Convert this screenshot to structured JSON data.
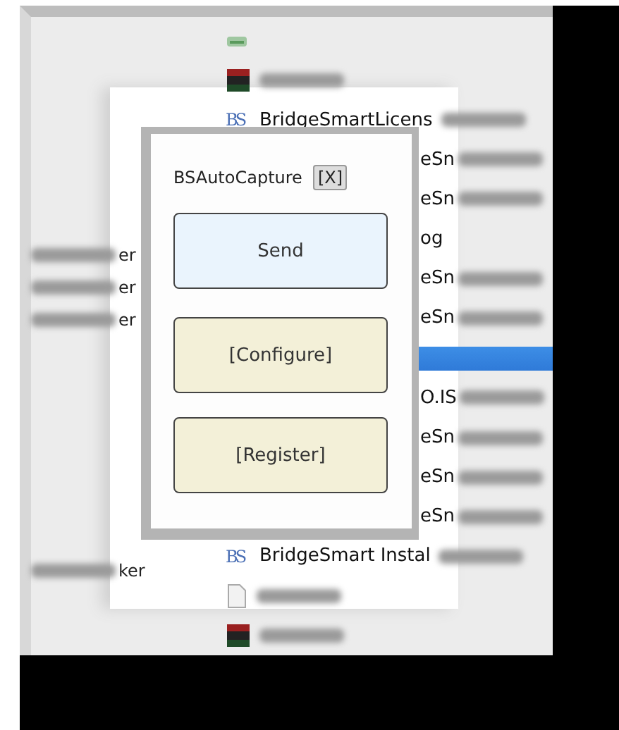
{
  "left_pane": {
    "items": [
      {
        "text": "er",
        "blurred": true
      },
      {
        "text": "er",
        "blurred": true
      },
      {
        "text": "er",
        "blurred": true
      },
      {
        "text": "ker",
        "blurred": true
      }
    ]
  },
  "file_list": {
    "items": [
      {
        "kind": "drive",
        "blurred": false,
        "selected": false
      },
      {
        "kind": "archive",
        "blurred": true,
        "selected": false
      },
      {
        "kind": "logo",
        "logo": "BS",
        "text": "BridgeSmartLicens",
        "blurred": true,
        "selected": false
      },
      {
        "kind": "covered",
        "text": "eSn",
        "blurred": true,
        "selected": false
      },
      {
        "kind": "covered",
        "text": "eSn",
        "blurred": true,
        "selected": false
      },
      {
        "kind": "covered",
        "text": "og",
        "blurred": false,
        "selected": false
      },
      {
        "kind": "covered",
        "text": "eSn",
        "blurred": true,
        "selected": false
      },
      {
        "kind": "covered",
        "text": "eSn",
        "blurred": true,
        "selected": false
      },
      {
        "kind": "covered",
        "blurred": false,
        "selected": true
      },
      {
        "kind": "covered",
        "text": "O.IS",
        "blurred": true,
        "selected": false
      },
      {
        "kind": "covered",
        "text": "eSn",
        "blurred": true,
        "selected": false
      },
      {
        "kind": "covered",
        "text": "eSn",
        "blurred": true,
        "selected": false
      },
      {
        "kind": "covered",
        "text": "eSn",
        "blurred": true,
        "selected": false
      },
      {
        "kind": "logo",
        "logo": "BS",
        "text": "BridgeSmart Instal",
        "blurred": true,
        "selected": false
      },
      {
        "kind": "file",
        "blurred": true,
        "selected": false
      },
      {
        "kind": "archive",
        "blurred": true,
        "selected": false
      }
    ]
  },
  "dialog": {
    "title": "BSAutoCapture",
    "close": "[X]",
    "buttons": [
      {
        "label": "Send",
        "kind": "primary"
      },
      {
        "label": "[Configure]",
        "kind": "secondary"
      },
      {
        "label": "[Register]",
        "kind": "secondary"
      }
    ]
  }
}
